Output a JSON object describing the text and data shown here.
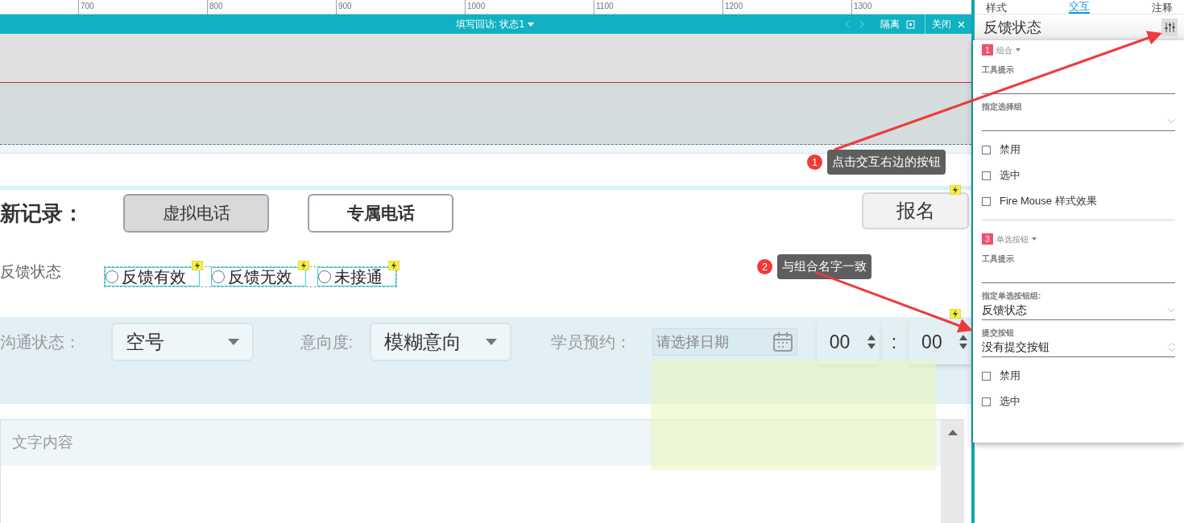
{
  "ruler": {
    "ticks": [
      "700",
      "800",
      "900",
      "1000",
      "1100",
      "1200",
      "1300"
    ]
  },
  "toolbar": {
    "title": "填写回访: 状态1",
    "isolate": "隔离",
    "close": "关闭"
  },
  "canvas": {
    "heading": "新记录：",
    "buttons": [
      {
        "label": "虚拟电话",
        "selected": true
      },
      {
        "label": "专属电话",
        "selected": false
      }
    ],
    "signup": "报名",
    "radio_group": {
      "label": "反馈状态",
      "options": [
        {
          "label": "反馈有效",
          "selected": false
        },
        {
          "label": "反馈无效",
          "selected": false
        },
        {
          "label": "未接通",
          "selected": false
        }
      ]
    },
    "status_label": "沟通状态：",
    "status_value": "空号",
    "intent_label": "意向度:",
    "intent_value": "模糊意向",
    "booking_label": "学员预约：",
    "date_placeholder": "请选择日期",
    "hour": "00",
    "separator": ":",
    "minute": "00",
    "text_placeholder": "文字内容"
  },
  "callouts": [
    {
      "number": "1",
      "text": "点击交互右边的按钮"
    },
    {
      "number": "2",
      "text": "与组合名字一致"
    }
  ],
  "panel": {
    "tabs": [
      {
        "label": "样式",
        "selected": false
      },
      {
        "label": "交互",
        "selected": true
      },
      {
        "label": "注释",
        "selected": false
      }
    ],
    "title": "反馈状态",
    "sections": [
      {
        "badge": "1",
        "name": "组合",
        "fields": [
          {
            "kind": "text",
            "label": "工具提示"
          },
          {
            "kind": "select",
            "label": "指定选择组"
          }
        ],
        "checks": [
          {
            "label": "禁用",
            "checked": false
          },
          {
            "label": "选中",
            "checked": false
          },
          {
            "label": "Fire Mouse 样式效果",
            "checked": false
          }
        ]
      },
      {
        "badge": "3",
        "name": "单选按钮",
        "fields": [
          {
            "kind": "text",
            "label": "工具提示"
          },
          {
            "kind": "select",
            "label": "指定单选按钮组:",
            "value": "反馈状态"
          },
          {
            "kind": "spinner",
            "label": "提交按钮",
            "value": "没有提交按钮"
          }
        ],
        "checks": [
          {
            "label": "禁用",
            "checked": false
          },
          {
            "label": "选中",
            "checked": false
          }
        ]
      }
    ]
  }
}
